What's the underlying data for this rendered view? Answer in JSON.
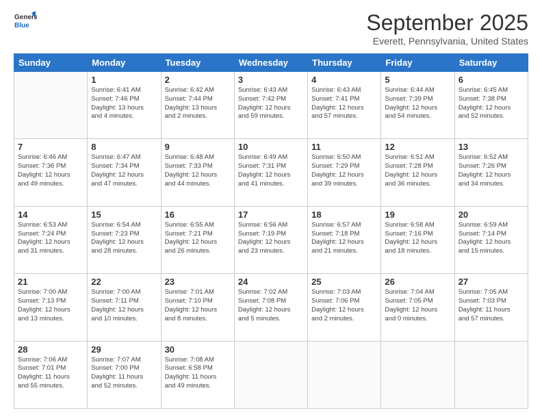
{
  "logo": {
    "general": "General",
    "blue": "Blue"
  },
  "title": "September 2025",
  "subtitle": "Everett, Pennsylvania, United States",
  "days_of_week": [
    "Sunday",
    "Monday",
    "Tuesday",
    "Wednesday",
    "Thursday",
    "Friday",
    "Saturday"
  ],
  "weeks": [
    [
      {
        "day": "",
        "info": ""
      },
      {
        "day": "1",
        "info": "Sunrise: 6:41 AM\nSunset: 7:46 PM\nDaylight: 13 hours\nand 4 minutes."
      },
      {
        "day": "2",
        "info": "Sunrise: 6:42 AM\nSunset: 7:44 PM\nDaylight: 13 hours\nand 2 minutes."
      },
      {
        "day": "3",
        "info": "Sunrise: 6:43 AM\nSunset: 7:42 PM\nDaylight: 12 hours\nand 59 minutes."
      },
      {
        "day": "4",
        "info": "Sunrise: 6:43 AM\nSunset: 7:41 PM\nDaylight: 12 hours\nand 57 minutes."
      },
      {
        "day": "5",
        "info": "Sunrise: 6:44 AM\nSunset: 7:39 PM\nDaylight: 12 hours\nand 54 minutes."
      },
      {
        "day": "6",
        "info": "Sunrise: 6:45 AM\nSunset: 7:38 PM\nDaylight: 12 hours\nand 52 minutes."
      }
    ],
    [
      {
        "day": "7",
        "info": "Sunrise: 6:46 AM\nSunset: 7:36 PM\nDaylight: 12 hours\nand 49 minutes."
      },
      {
        "day": "8",
        "info": "Sunrise: 6:47 AM\nSunset: 7:34 PM\nDaylight: 12 hours\nand 47 minutes."
      },
      {
        "day": "9",
        "info": "Sunrise: 6:48 AM\nSunset: 7:33 PM\nDaylight: 12 hours\nand 44 minutes."
      },
      {
        "day": "10",
        "info": "Sunrise: 6:49 AM\nSunset: 7:31 PM\nDaylight: 12 hours\nand 41 minutes."
      },
      {
        "day": "11",
        "info": "Sunrise: 6:50 AM\nSunset: 7:29 PM\nDaylight: 12 hours\nand 39 minutes."
      },
      {
        "day": "12",
        "info": "Sunrise: 6:51 AM\nSunset: 7:28 PM\nDaylight: 12 hours\nand 36 minutes."
      },
      {
        "day": "13",
        "info": "Sunrise: 6:52 AM\nSunset: 7:26 PM\nDaylight: 12 hours\nand 34 minutes."
      }
    ],
    [
      {
        "day": "14",
        "info": "Sunrise: 6:53 AM\nSunset: 7:24 PM\nDaylight: 12 hours\nand 31 minutes."
      },
      {
        "day": "15",
        "info": "Sunrise: 6:54 AM\nSunset: 7:23 PM\nDaylight: 12 hours\nand 28 minutes."
      },
      {
        "day": "16",
        "info": "Sunrise: 6:55 AM\nSunset: 7:21 PM\nDaylight: 12 hours\nand 26 minutes."
      },
      {
        "day": "17",
        "info": "Sunrise: 6:56 AM\nSunset: 7:19 PM\nDaylight: 12 hours\nand 23 minutes."
      },
      {
        "day": "18",
        "info": "Sunrise: 6:57 AM\nSunset: 7:18 PM\nDaylight: 12 hours\nand 21 minutes."
      },
      {
        "day": "19",
        "info": "Sunrise: 6:58 AM\nSunset: 7:16 PM\nDaylight: 12 hours\nand 18 minutes."
      },
      {
        "day": "20",
        "info": "Sunrise: 6:59 AM\nSunset: 7:14 PM\nDaylight: 12 hours\nand 15 minutes."
      }
    ],
    [
      {
        "day": "21",
        "info": "Sunrise: 7:00 AM\nSunset: 7:13 PM\nDaylight: 12 hours\nand 13 minutes."
      },
      {
        "day": "22",
        "info": "Sunrise: 7:00 AM\nSunset: 7:11 PM\nDaylight: 12 hours\nand 10 minutes."
      },
      {
        "day": "23",
        "info": "Sunrise: 7:01 AM\nSunset: 7:10 PM\nDaylight: 12 hours\nand 8 minutes."
      },
      {
        "day": "24",
        "info": "Sunrise: 7:02 AM\nSunset: 7:08 PM\nDaylight: 12 hours\nand 5 minutes."
      },
      {
        "day": "25",
        "info": "Sunrise: 7:03 AM\nSunset: 7:06 PM\nDaylight: 12 hours\nand 2 minutes."
      },
      {
        "day": "26",
        "info": "Sunrise: 7:04 AM\nSunset: 7:05 PM\nDaylight: 12 hours\nand 0 minutes."
      },
      {
        "day": "27",
        "info": "Sunrise: 7:05 AM\nSunset: 7:03 PM\nDaylight: 11 hours\nand 57 minutes."
      }
    ],
    [
      {
        "day": "28",
        "info": "Sunrise: 7:06 AM\nSunset: 7:01 PM\nDaylight: 11 hours\nand 55 minutes."
      },
      {
        "day": "29",
        "info": "Sunrise: 7:07 AM\nSunset: 7:00 PM\nDaylight: 11 hours\nand 52 minutes."
      },
      {
        "day": "30",
        "info": "Sunrise: 7:08 AM\nSunset: 6:58 PM\nDaylight: 11 hours\nand 49 minutes."
      },
      {
        "day": "",
        "info": ""
      },
      {
        "day": "",
        "info": ""
      },
      {
        "day": "",
        "info": ""
      },
      {
        "day": "",
        "info": ""
      }
    ]
  ]
}
